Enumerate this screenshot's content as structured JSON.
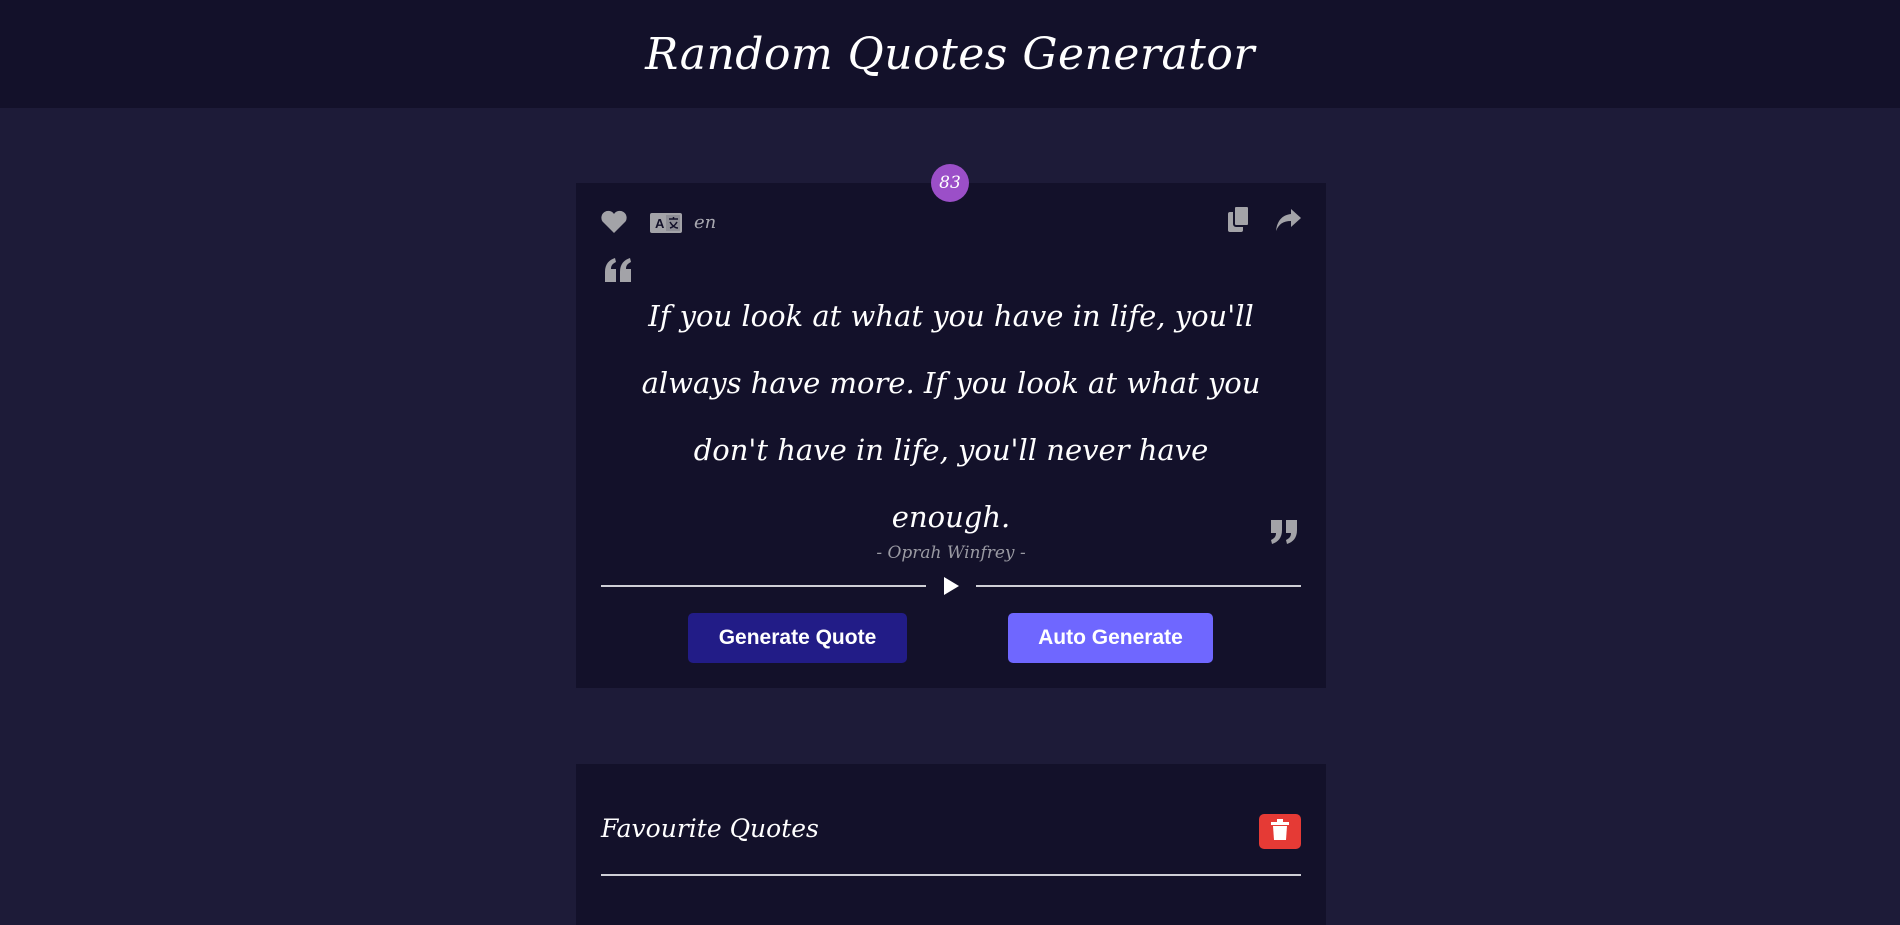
{
  "header": {
    "title": "Random Quotes Generator"
  },
  "quote_card": {
    "count": "83",
    "language": "en",
    "quote": "If you look at what you have in life, you'll always have more. If you look at what you don't have in life, you'll never have enough.",
    "author": "- Oprah Winfrey -",
    "generate_label": "Generate Quote",
    "auto_label": "Auto Generate"
  },
  "favourites": {
    "title": "Favourite Quotes"
  },
  "icons": {
    "heart": "heart-icon",
    "translate": "translate-icon",
    "copy": "copy-icon",
    "share": "share-icon",
    "open_quote": "quote-left-icon",
    "close_quote": "quote-right-icon",
    "play": "play-icon",
    "trash": "trash-icon"
  },
  "colors": {
    "background": "#1d1b38",
    "card": "#13112a",
    "badge": "#9b4fc8",
    "generate_button": "#221c87",
    "auto_button": "#6f67ff",
    "trash_button": "#e53a35"
  }
}
